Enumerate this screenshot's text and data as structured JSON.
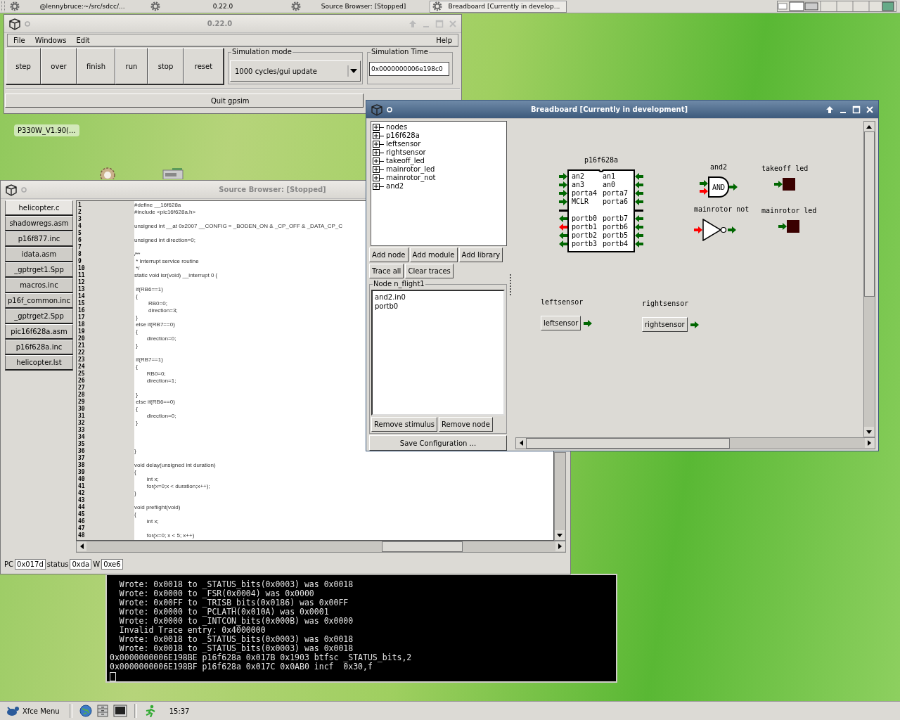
{
  "top_panel": {
    "tasks": [
      {
        "label": "@lennybruce:~/src/sdcc/...",
        "selected": false
      },
      {
        "label": "0.22.0",
        "selected": false
      },
      {
        "label": "Source Browser: [Stopped]",
        "selected": false
      },
      {
        "label": "Breadboard [Currently in develop...",
        "selected": true
      }
    ]
  },
  "desktop": {
    "icon_label": "P330W_V1.90(..."
  },
  "main_window": {
    "title": "0.22.0",
    "menu": [
      "File",
      "Windows",
      "Edit"
    ],
    "help_menu": "Help",
    "buttons": [
      "step",
      "over",
      "finish",
      "run",
      "stop",
      "reset"
    ],
    "simulation_mode": {
      "label": "Simulation mode",
      "value": "1000 cycles/gui update"
    },
    "simulation_time": {
      "label": "Simulation Time",
      "value": "0x0000000006e198c0"
    },
    "quit_button": "Quit gpsim"
  },
  "source_browser": {
    "title": "Source Browser: [Stopped]",
    "files": [
      {
        "label": "helicopter.c",
        "selected": true
      },
      {
        "label": "shadowregs.asm",
        "selected": false
      },
      {
        "label": "p16f877.inc",
        "selected": false
      },
      {
        "label": "idata.asm",
        "selected": false
      },
      {
        "label": "_gptrget1.Spp",
        "selected": false
      },
      {
        "label": "macros.inc",
        "selected": false
      },
      {
        "label": "p16f_common.inc",
        "selected": false
      },
      {
        "label": "_gptrget2.Spp",
        "selected": false
      },
      {
        "label": "pic16f628a.asm",
        "selected": false
      },
      {
        "label": "p16f628a.inc",
        "selected": false
      },
      {
        "label": "helicopter.lst",
        "selected": false
      }
    ],
    "lines": [
      {
        "number": "1",
        "code": "#define __16f628a"
      },
      {
        "number": "2",
        "code": "#include <pic16f628a.h>"
      },
      {
        "number": "3"
      },
      {
        "number": "4",
        "code": "unsigned int __at 0x2007 __CONFIG = _BODEN_ON & _CP_OFF & _DATA_CP_C"
      },
      {
        "number": "5"
      },
      {
        "number": "6",
        "code": "unsigned int direction=0;"
      },
      {
        "number": "7"
      },
      {
        "number": "8",
        "code": "/**"
      },
      {
        "number": "9",
        "code": " * Interrupt service routine"
      },
      {
        "number": "10",
        "code": " */"
      },
      {
        "number": "11",
        "code": "static void isr(void) __interrupt 0 {"
      },
      {
        "number": "12"
      },
      {
        "number": "13",
        "code": " if(RB6==1)"
      },
      {
        "number": "14",
        "code": " {"
      },
      {
        "number": "15",
        "code": "         RB0=0;"
      },
      {
        "number": "16",
        "code": "         direction=3;"
      },
      {
        "number": "17",
        "code": " }"
      },
      {
        "number": "18",
        "code": " else if(RB7==0)"
      },
      {
        "number": "19",
        "code": " {"
      },
      {
        "number": "20",
        "code": "        direction=0;"
      },
      {
        "number": "21",
        "code": " }"
      },
      {
        "number": "22"
      },
      {
        "number": "23",
        "code": " if(RB7==1)"
      },
      {
        "number": "24",
        "code": " {"
      },
      {
        "number": "25",
        "code": "        RB0=0;"
      },
      {
        "number": "26",
        "code": "        direction=1;"
      },
      {
        "number": "27"
      },
      {
        "number": "28",
        "code": " }"
      },
      {
        "number": "29",
        "code": " else if(RB6==0)"
      },
      {
        "number": "30",
        "code": " {"
      },
      {
        "number": "31",
        "code": "        direction=0;"
      },
      {
        "number": "32",
        "code": " }"
      },
      {
        "number": "33"
      },
      {
        "number": "34"
      },
      {
        "number": "35"
      },
      {
        "number": "36",
        "code": "}"
      },
      {
        "number": "37"
      },
      {
        "number": "38",
        "code": "void delay(unsigned int duration)"
      },
      {
        "number": "39",
        "code": "{"
      },
      {
        "number": "40",
        "code": "        int x;"
      },
      {
        "number": "41",
        "code": "        for(x=0;x < duration;x++);"
      },
      {
        "number": "42",
        "code": "}"
      },
      {
        "number": "43"
      },
      {
        "number": "44",
        "code": "void preflight(void)"
      },
      {
        "number": "45",
        "code": "{"
      },
      {
        "number": "46",
        "code": "        int x;"
      },
      {
        "number": "47"
      },
      {
        "number": "48",
        "code": "        for(x=0; x < 5; x++)"
      }
    ],
    "status": [
      {
        "label": "PC",
        "value": "0x017d"
      },
      {
        "label": "status",
        "value": "0xda"
      },
      {
        "label": "W",
        "value": "0xe6"
      }
    ]
  },
  "terminal": {
    "lines": [
      "  Wrote: 0x0018 to _STATUS_bits(0x0003) was 0x0018",
      "  Wrote: 0x0000 to _FSR(0x0004) was 0x0000",
      "  Wrote: 0x00FF to _TRISB_bits(0x0186) was 0x00FF",
      "  Wrote: 0x0000 to _PCLATH(0x010A) was 0x0001",
      "  Wrote: 0x0000 to _INTCON_bits(0x000B) was 0x0000",
      "  Invalid Trace entry: 0x4000000",
      "  Wrote: 0x0018 to _STATUS_bits(0x0003) was 0x0018",
      "  Wrote: 0x0018 to _STATUS_bits(0x0003) was 0x0018",
      "0x0000000006E198BE p16f628a 0x017B 0x1903 btfsc _STATUS_bits,2",
      "0x0000000006E198BF p16f628a 0x017C 0x0AB0 incf  0x30,f"
    ]
  },
  "breadboard": {
    "title": "Breadboard [Currently in development]",
    "tree": [
      {
        "label": "nodes",
        "expanded": false
      },
      {
        "label": "p16f628a",
        "expanded": false
      },
      {
        "label": "leftsensor",
        "expanded": false
      },
      {
        "label": "rightsensor",
        "expanded": false
      },
      {
        "label": "takeoff_led",
        "expanded": false
      },
      {
        "label": "mainrotor_led",
        "expanded": false
      },
      {
        "label": "mainrotor_not",
        "expanded": false
      },
      {
        "label": "and2",
        "expanded": false
      }
    ],
    "button_rows": [
      [
        "Add node",
        "Add module",
        "Add library"
      ],
      [
        "Trace all",
        "Clear traces"
      ]
    ],
    "node_frame": {
      "label": "Node n_flight1",
      "items": [
        "and2.in0",
        "portb0"
      ]
    },
    "node_buttons": [
      "Remove stimulus",
      "Remove node"
    ],
    "save_button": "Save Configuration ...",
    "modules": [
      {
        "kind": "chip",
        "label": "p16f628a",
        "pin_groups": [
          {
            "left": [
              {
                "label": "an2",
                "kind": "input",
                "color": "#006600"
              },
              {
                "label": "an3",
                "kind": "input",
                "color": "#006600"
              },
              {
                "label": "porta4",
                "kind": "input",
                "color": "#006600"
              },
              {
                "label": "MCLR",
                "kind": "input",
                "color": "#006600"
              }
            ],
            "right": [
              {
                "label": "an1",
                "kind": "input",
                "color": "#006600"
              },
              {
                "label": "an0",
                "kind": "input",
                "color": "#006600"
              },
              {
                "label": "porta7",
                "kind": "input",
                "color": "#006600"
              },
              {
                "label": "porta6",
                "kind": "input",
                "color": "#006600"
              }
            ]
          },
          {
            "left": [
              {
                "label": "portb0",
                "kind": "output",
                "color": "#006600"
              },
              {
                "label": "portb1",
                "kind": "output",
                "color": "#ff0000"
              },
              {
                "label": "portb2",
                "kind": "output",
                "color": "#006600"
              },
              {
                "label": "portb3",
                "kind": "output",
                "color": "#006600"
              }
            ],
            "right": [
              {
                "label": "portb7",
                "kind": "input",
                "color": "#006600"
              },
              {
                "label": "portb6",
                "kind": "input",
                "color": "#006600"
              },
              {
                "label": "portb5",
                "kind": "input",
                "color": "#006600"
              },
              {
                "label": "portb4",
                "kind": "input",
                "color": "#006600"
              }
            ]
          }
        ]
      },
      {
        "kind": "and",
        "label": "and2",
        "text": "AND",
        "inputs": [
          {
            "color": "#006600"
          },
          {
            "color": "#ff0000"
          }
        ],
        "output": {
          "color": "#006600"
        }
      },
      {
        "kind": "led",
        "label": "takeoff led",
        "on": false,
        "input": {
          "color": "#006600"
        }
      },
      {
        "kind": "not",
        "label": "mainrotor not",
        "inputs": [
          {
            "color": "#ff0000"
          }
        ],
        "output": {
          "color": "#006600"
        }
      },
      {
        "kind": "led",
        "label": "mainrotor led",
        "on": false,
        "input": {
          "color": "#006600"
        }
      },
      {
        "kind": "switch",
        "label": "leftsensor",
        "button": "leftsensor",
        "output": {
          "color": "#006600"
        }
      },
      {
        "kind": "switch",
        "label": "rightsensor",
        "button": "rightsensor",
        "output": {
          "color": "#006600"
        }
      }
    ]
  },
  "bottom_panel": {
    "menu": "Xfce Menu",
    "clock": "15:37"
  }
}
